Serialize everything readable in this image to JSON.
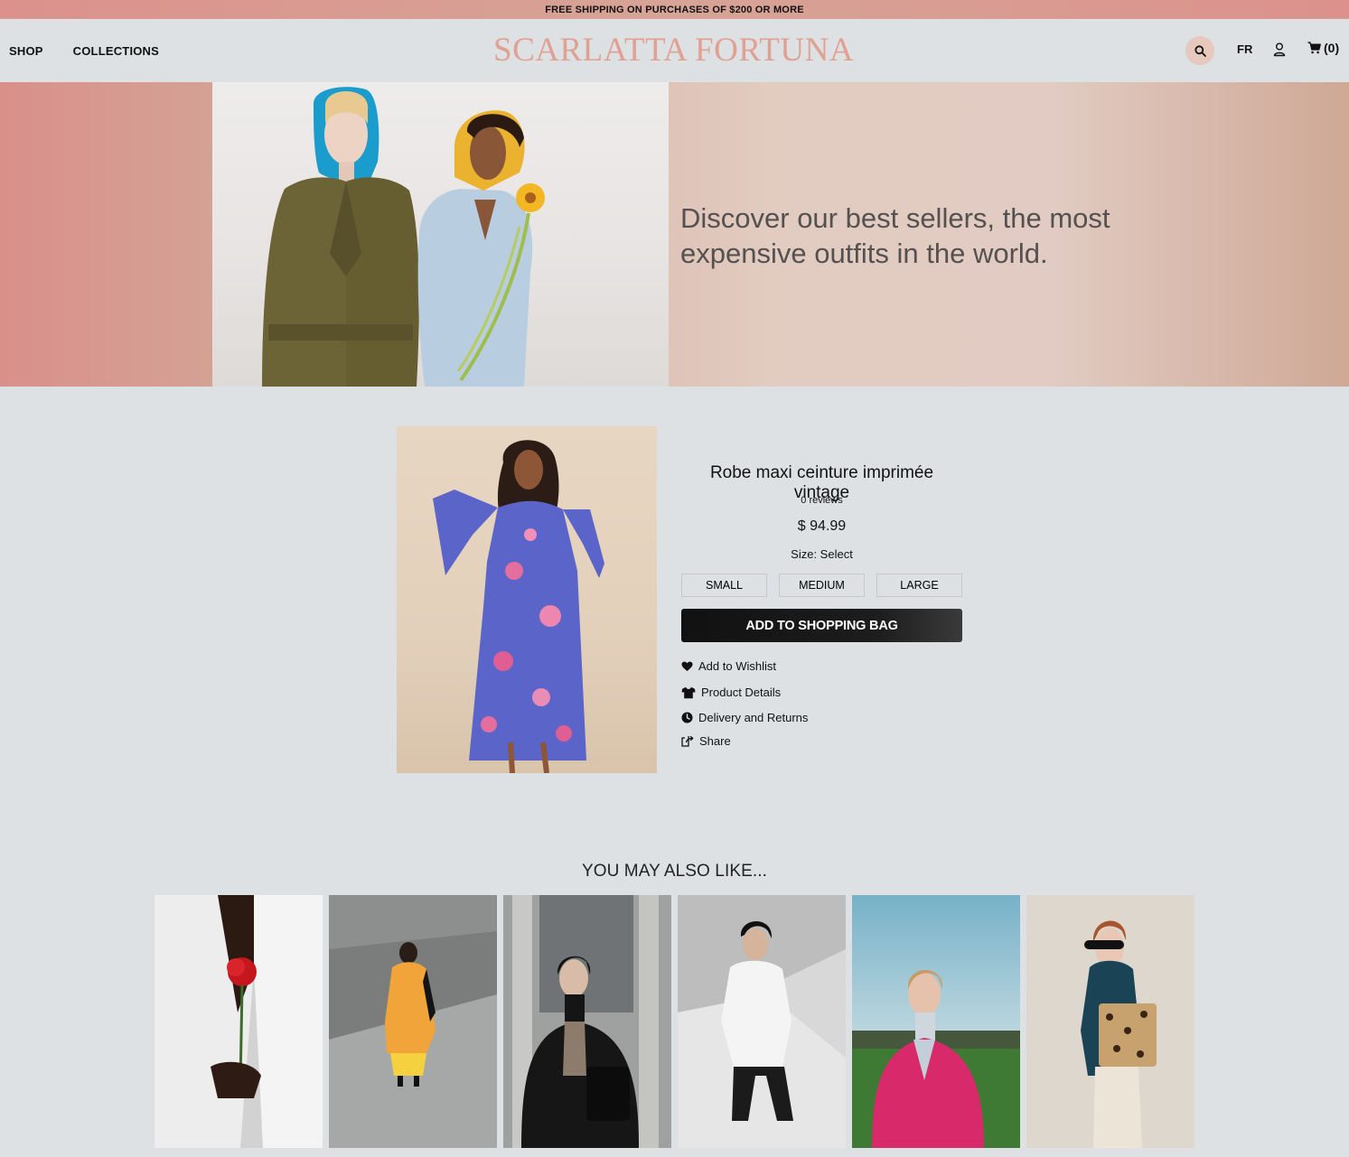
{
  "promo": {
    "text": "FREE SHIPPING ON PURCHASES OF $200 OR MORE"
  },
  "header": {
    "nav": [
      {
        "label": "SHOP"
      },
      {
        "label": "COLLECTIONS"
      }
    ],
    "logo": "SCARLATTA FORTUNA",
    "search_icon": "search-icon",
    "language": "FR",
    "user_icon": "user-icon",
    "cart": {
      "icon": "cart-icon",
      "count_label": "(0)"
    }
  },
  "hero": {
    "headline": "Discover our best sellers, the most expensive outfits in the world."
  },
  "product": {
    "title": "Robe maxi ceinture imprimée vintage",
    "reviews": "0 reviews",
    "price": "$ 94.99",
    "size_label": "Size: Select",
    "sizes": [
      "SMALL",
      "MEDIUM",
      "LARGE"
    ],
    "add_button": "ADD TO SHOPPING BAG",
    "actions": [
      {
        "label": "Add to Wishlist",
        "icon": "heart-icon"
      },
      {
        "label": "Product Details",
        "icon": "shirt-icon"
      },
      {
        "label": "Delivery and Returns",
        "icon": "clock-icon"
      },
      {
        "label": "Share",
        "icon": "share-icon"
      }
    ]
  },
  "recommendations": {
    "title": "YOU MAY ALSO LIKE..."
  },
  "colors": {
    "promo_bg": "#dc918c",
    "logo": "#e0a192",
    "page_bg": "#dde1e3",
    "search_bg": "#e6c8bc",
    "button_bg": "#111111"
  }
}
